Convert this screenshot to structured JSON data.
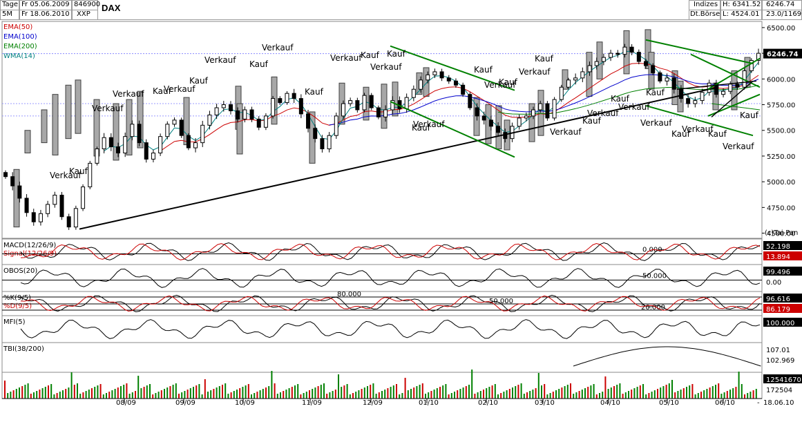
{
  "header": {
    "period_label": "Tage",
    "interval_label": "5M",
    "date_from": "Fr 05.06.2009",
    "date_to": "Fr 18.06.2010",
    "wkn": "846900",
    "exchange_code": "XXP",
    "symbol": "DAX",
    "category": "Indizes",
    "exchange": "Dt.Börse",
    "high_label": "H: 6341.52",
    "low_label": "L: 4524.01",
    "last_value": "6246.74",
    "last_date": "23.0/1169."
  },
  "legend": [
    {
      "name": "EMA(50)",
      "color": "#cc0000"
    },
    {
      "name": "EMA(100)",
      "color": "#0000cc"
    },
    {
      "name": "EMA(200)",
      "color": "#008000"
    },
    {
      "name": "WMA(14)",
      "color": "#008080"
    }
  ],
  "copyright": "(c)Tai-Pan",
  "chart_data": {
    "type": "candlestick",
    "title": "DAX",
    "y_ticks": [
      "6500.00",
      "6250.00",
      "6000.00",
      "5750.00",
      "5500.00",
      "5250.00",
      "5000.00",
      "4750.00",
      "4500.00"
    ],
    "ylim": [
      4450,
      6560
    ],
    "x_ticks": [
      "08/09",
      "09/09",
      "10/09",
      "11/09",
      "12/09",
      "01/10",
      "02/10",
      "03/10",
      "04/10",
      "05/10",
      "06/10"
    ],
    "last_price_tag": "6246.74",
    "close_series": [
      5050,
      4960,
      4840,
      4700,
      4610,
      4690,
      4780,
      4870,
      4660,
      4560,
      4740,
      4950,
      5180,
      5320,
      5430,
      5340,
      5280,
      5440,
      5560,
      5380,
      5220,
      5280,
      5440,
      5560,
      5600,
      5450,
      5330,
      5380,
      5550,
      5650,
      5720,
      5750,
      5690,
      5610,
      5700,
      5610,
      5530,
      5640,
      5810,
      5770,
      5860,
      5810,
      5660,
      5520,
      5420,
      5320,
      5450,
      5640,
      5760,
      5790,
      5700,
      5840,
      5720,
      5630,
      5700,
      5790,
      5710,
      5820,
      5900,
      5990,
      6040,
      6070,
      6010,
      5980,
      5940,
      5850,
      5720,
      5640,
      5600,
      5540,
      5480,
      5420,
      5540,
      5620,
      5640,
      5700,
      5760,
      5620,
      5800,
      5920,
      5990,
      6010,
      6070,
      6130,
      6170,
      6210,
      6250,
      6240,
      6310,
      6260,
      6170,
      6130,
      6060,
      5980,
      6010,
      5900,
      5810,
      5760,
      5790,
      5870,
      5960,
      5850,
      5880,
      5950,
      5920,
      6080,
      6180,
      6250
    ],
    "labels_kauf": [
      "Kauf",
      "Kauf",
      "Kauf",
      "Kauf",
      "Kauf",
      "Kauf",
      "Kauf",
      "Kauf",
      "Kauf",
      "Kauf",
      "Kauf",
      "Kauf",
      "Kauf",
      "Kauf",
      "Kauf",
      "Kauf",
      "Kauf"
    ],
    "labels_verkauf": [
      "Verkauf",
      "Verkauf",
      "Verkauf",
      "Verkauf",
      "Verkauf",
      "Verkauf",
      "Verkauf",
      "Verkauf",
      "Verkauf",
      "Verkauf",
      "Verkauf",
      "Verkauf",
      "Verkauf",
      "Verkauf",
      "Verkauf",
      "Verkauf",
      "Verkauf",
      "Verkauf"
    ]
  },
  "indicators": [
    {
      "key": "macd",
      "label": "MACD(12/26/9)",
      "label2": "Signal(12/26/9)",
      "level": "0.000",
      "value1": "52.198",
      "value2": "13.894",
      "color2": "#cc0000"
    },
    {
      "key": "obos",
      "label": "OBOS(20)",
      "level": "50.000",
      "value1": "99.496",
      "value2": "0.00"
    },
    {
      "key": "stoch",
      "label": "%K(9/5)",
      "label2": "%D(9/5)",
      "levels": [
        "80.000",
        "50.000",
        "20.000"
      ],
      "value1": "96.616",
      "value2": "86.179",
      "color2": "#cc0000"
    },
    {
      "key": "mfi",
      "label": "MFI(5)",
      "value1": "100.000"
    },
    {
      "key": "tbi",
      "label": "TBI(38/200)",
      "value1": "107.01",
      "value2": "102.969"
    },
    {
      "key": "vol",
      "label": "",
      "value1": "12541670",
      "value2": "172504"
    }
  ],
  "footer": {
    "dash": "-",
    "date": "18.06.10"
  }
}
